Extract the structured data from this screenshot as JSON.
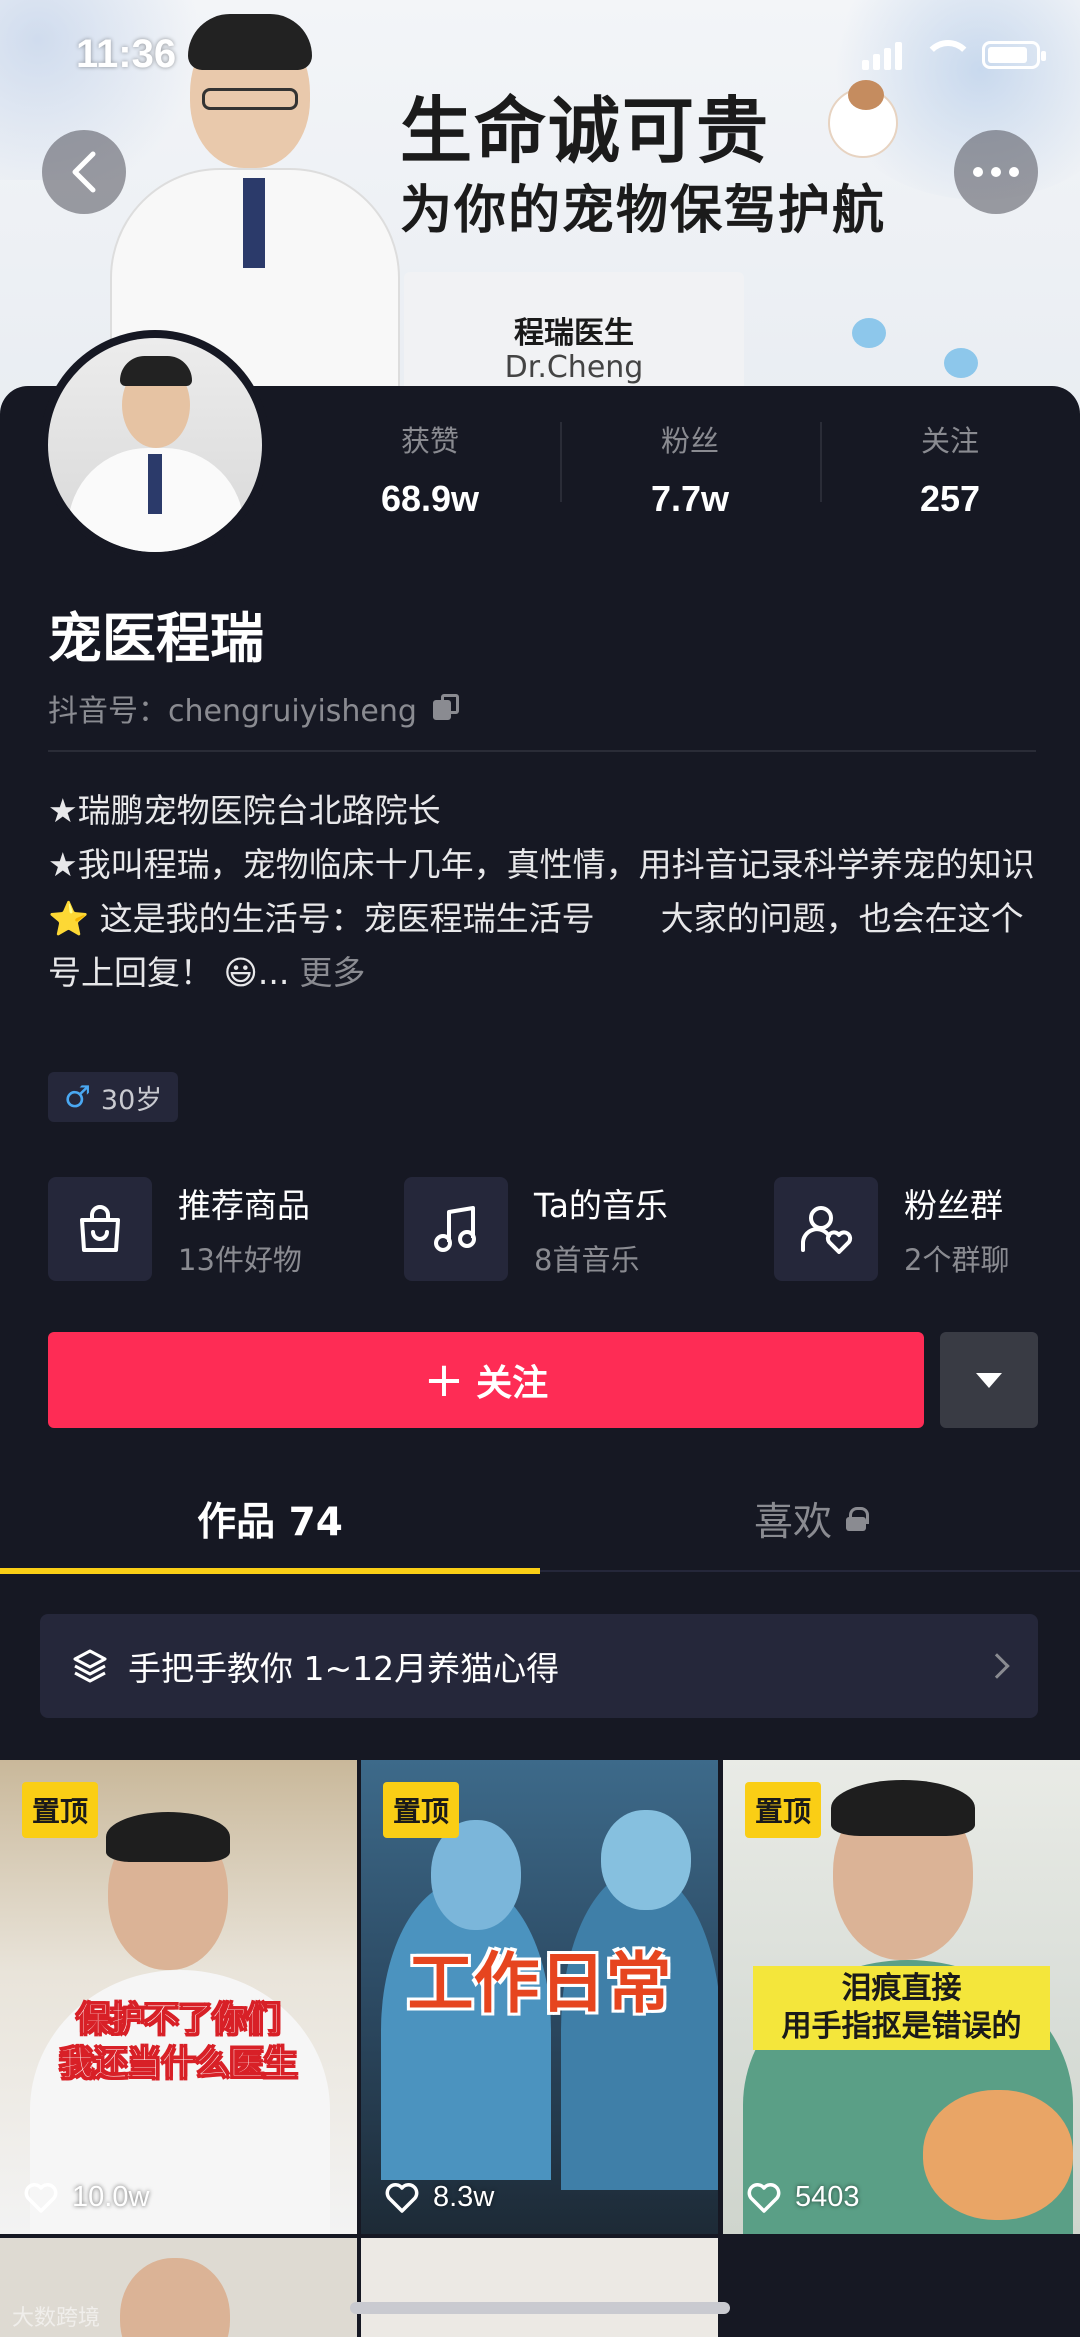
{
  "status_bar": {
    "time": "11:36"
  },
  "banner": {
    "title_line1": "生命诚可贵",
    "title_line2": "为你的宠物保驾护航",
    "card_name": "程瑞医生",
    "card_en": "Dr.Cheng"
  },
  "profile": {
    "stats": [
      {
        "label": "获赞",
        "value": "68.9w"
      },
      {
        "label": "粉丝",
        "value": "7.7w"
      },
      {
        "label": "关注",
        "value": "257"
      }
    ],
    "name": "宠医程瑞",
    "douyin_id": "抖音号：chengruiyisheng",
    "bio": {
      "line1": "★瑞鹏宠物医院台北路院长",
      "line2": "★我叫程瑞，宠物临床十几年，真性情，用抖音记录科学养宠的知识",
      "line3": "⭐ 这是我的生活号：宠医程瑞生活号　　大家的问题，也会在这个号上回复！ 😃...",
      "more": "更多"
    },
    "gender_age": "30岁"
  },
  "entries": [
    {
      "title": "推荐商品",
      "sub": "13件好物",
      "icon": "shopping-bag-icon"
    },
    {
      "title": "Ta的音乐",
      "sub": "8首音乐",
      "icon": "music-note-icon"
    },
    {
      "title": "粉丝群",
      "sub": "2个群聊",
      "icon": "fan-group-icon"
    }
  ],
  "actions": {
    "follow_label": "关注"
  },
  "tabs": {
    "works": "作品 74",
    "likes": "喜欢"
  },
  "collection": {
    "title": "手把手教你 1~12月养猫心得"
  },
  "videos": [
    {
      "pin": "置顶",
      "overlay": "保护不了你们\n我还当什么医生",
      "likes": "10.0w"
    },
    {
      "pin": "置顶",
      "overlay": "工作日常",
      "likes": "8.3w"
    },
    {
      "pin": "置顶",
      "overlay": "泪痕直接\n用手指抠是错误的",
      "likes": "5403"
    }
  ],
  "watermark": "大数跨境",
  "colors": {
    "accent": "#fe2c55",
    "tab_indicator": "#face15",
    "background": "#161823"
  }
}
